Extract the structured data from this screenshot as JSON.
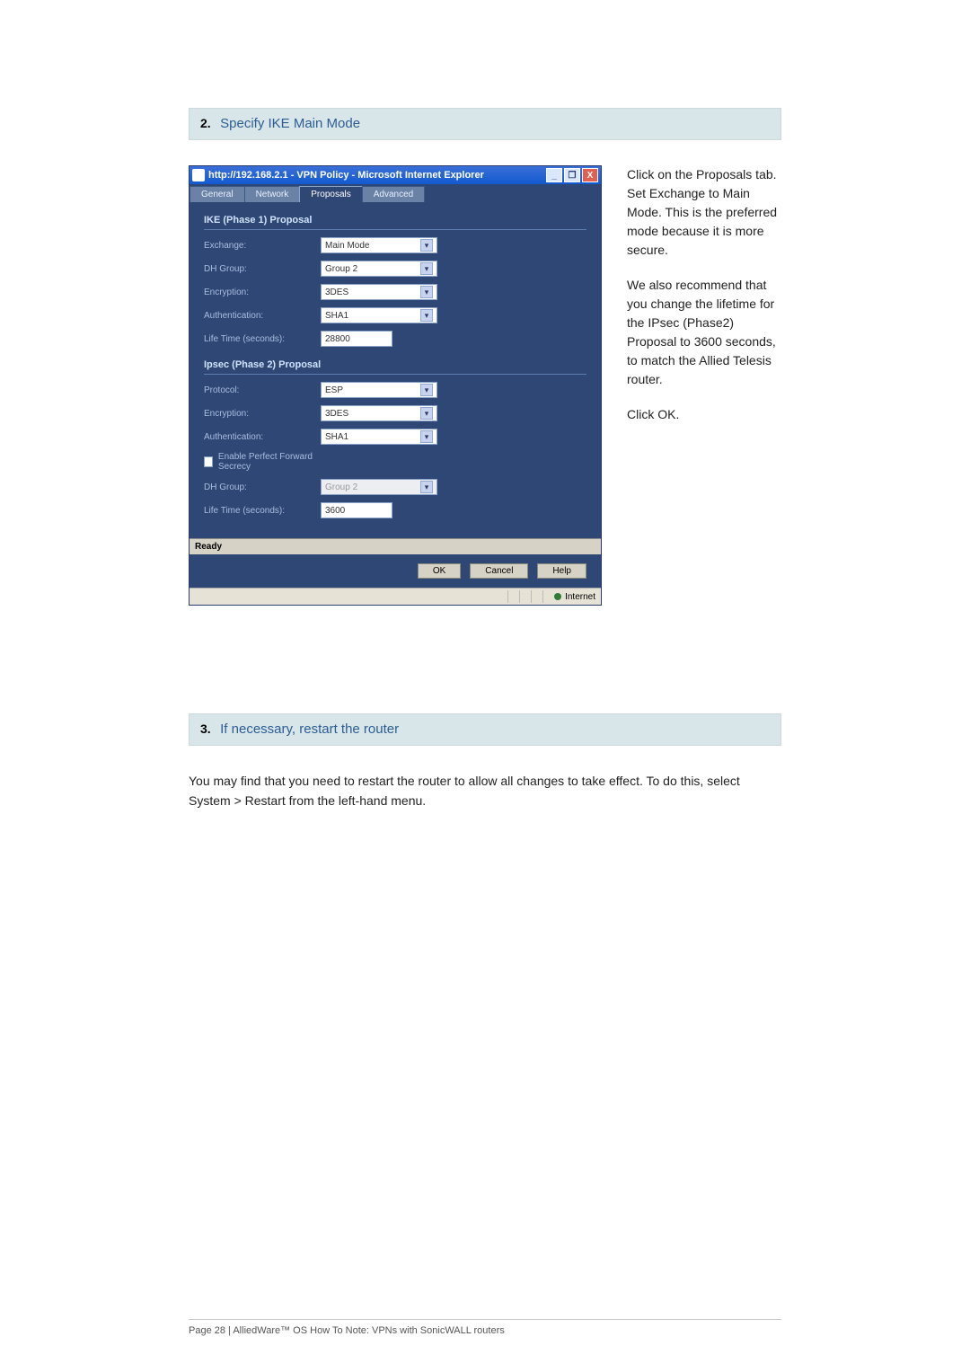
{
  "step2": {
    "num": "2.",
    "title": "Specify IKE Main Mode"
  },
  "ie": {
    "title": "http://192.168.2.1 - VPN Policy - Microsoft Internet Explorer",
    "min": "_",
    "max": "❐",
    "close": "X"
  },
  "tabs": {
    "general": "General",
    "network": "Network",
    "proposals": "Proposals",
    "advanced": "Advanced"
  },
  "phase1": {
    "heading": "IKE (Phase 1) Proposal",
    "exchange_label": "Exchange:",
    "exchange": "Main Mode",
    "dh_label": "DH Group:",
    "dh": "Group 2",
    "enc_label": "Encryption:",
    "enc": "3DES",
    "auth_label": "Authentication:",
    "auth": "SHA1",
    "life_label": "Life Time (seconds):",
    "life": "28800"
  },
  "phase2": {
    "heading": "Ipsec (Phase 2) Proposal",
    "proto_label": "Protocol:",
    "proto": "ESP",
    "enc_label": "Encryption:",
    "enc": "3DES",
    "auth_label": "Authentication:",
    "auth": "SHA1",
    "pfs_label": "Enable Perfect Forward Secrecy",
    "dh_label": "DH Group:",
    "dh": "Group 2",
    "life_label": "Life Time (seconds):",
    "life": "3600"
  },
  "statusbar": {
    "ready": "Ready",
    "internet": "Internet"
  },
  "buttons": {
    "ok": "OK",
    "cancel": "Cancel",
    "help": "Help"
  },
  "instr": {
    "p1": "Click on the Proposals tab. Set Exchange to Main Mode. This is the preferred mode because it is more secure.",
    "p2": "We also recommend that you change the lifetime for the IPsec (Phase2) Proposal to 3600 seconds, to match the Allied Telesis router.",
    "p3": "Click OK."
  },
  "step3": {
    "num": "3.",
    "title": "If necessary, restart the router",
    "body": "You may find that you need to restart the router to allow all changes to take effect. To do this, select System > Restart from the left-hand menu."
  },
  "footer": "Page 28 | AlliedWare™ OS How To Note: VPNs with SonicWALL routers"
}
